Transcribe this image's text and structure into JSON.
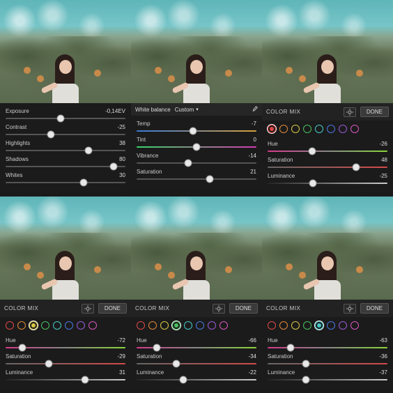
{
  "colors": {
    "red": "#e04848",
    "orange": "#e08a3a",
    "yellow": "#d8c848",
    "green": "#4ac060",
    "aqua": "#48c8c8",
    "blue": "#4878e0",
    "purple": "#9a5ad8",
    "magenta": "#d858c0"
  },
  "panels": [
    {
      "type": "light",
      "sliders": [
        {
          "label": "Exposure",
          "value": "-0,14EV",
          "pos": 46
        },
        {
          "label": "Contrast",
          "value": "-25",
          "pos": 38
        },
        {
          "label": "Highlights",
          "value": "38",
          "pos": 69
        },
        {
          "label": "Shadows",
          "value": "80",
          "pos": 90
        },
        {
          "label": "Whites",
          "value": "30",
          "pos": 65
        }
      ]
    },
    {
      "type": "color",
      "header": {
        "label": "White balance",
        "mode": "Custom"
      },
      "sliders": [
        {
          "label": "Temp",
          "value": "-7",
          "pos": 47,
          "grad": "temp"
        },
        {
          "label": "Tint",
          "value": "0",
          "pos": 50,
          "grad": "tint"
        },
        {
          "label": "Vibrance",
          "value": "-14",
          "pos": 43
        },
        {
          "label": "Saturation",
          "value": "21",
          "pos": 61
        }
      ]
    },
    {
      "type": "mix",
      "title": "COLOR MIX",
      "done": "DONE",
      "selected": "red",
      "sliders": [
        {
          "label": "Hue",
          "value": "-26",
          "pos": 37,
          "grad": "hue"
        },
        {
          "label": "Saturation",
          "value": "48",
          "pos": 74,
          "grad": "sat"
        },
        {
          "label": "Luminance",
          "value": "-25",
          "pos": 38,
          "grad": "lum"
        }
      ]
    },
    {
      "type": "mix",
      "title": "COLOR MIX",
      "done": "DONE",
      "selected": "yellow",
      "sliders": [
        {
          "label": "Hue",
          "value": "-72",
          "pos": 14,
          "grad": "hue"
        },
        {
          "label": "Saturation",
          "value": "-29",
          "pos": 36,
          "grad": "sat"
        },
        {
          "label": "Luminance",
          "value": "31",
          "pos": 66,
          "grad": "lum"
        }
      ]
    },
    {
      "type": "mix",
      "title": "COLOR MIX",
      "done": "DONE",
      "selected": "green",
      "sliders": [
        {
          "label": "Hue",
          "value": "-66",
          "pos": 17,
          "grad": "hue"
        },
        {
          "label": "Saturation",
          "value": "-34",
          "pos": 33,
          "grad": "sat"
        },
        {
          "label": "Luminance",
          "value": "-22",
          "pos": 39,
          "grad": "lum"
        }
      ]
    },
    {
      "type": "mix",
      "title": "COLOR MIX",
      "done": "DONE",
      "selected": "aqua",
      "sliders": [
        {
          "label": "Hue",
          "value": "-63",
          "pos": 19,
          "grad": "hue"
        },
        {
          "label": "Saturation",
          "value": "-36",
          "pos": 32,
          "grad": "sat"
        },
        {
          "label": "Luminance",
          "value": "-37",
          "pos": 32,
          "grad": "lum"
        }
      ]
    }
  ],
  "swatch_order": [
    "red",
    "orange",
    "yellow",
    "green",
    "aqua",
    "blue",
    "purple",
    "magenta"
  ]
}
